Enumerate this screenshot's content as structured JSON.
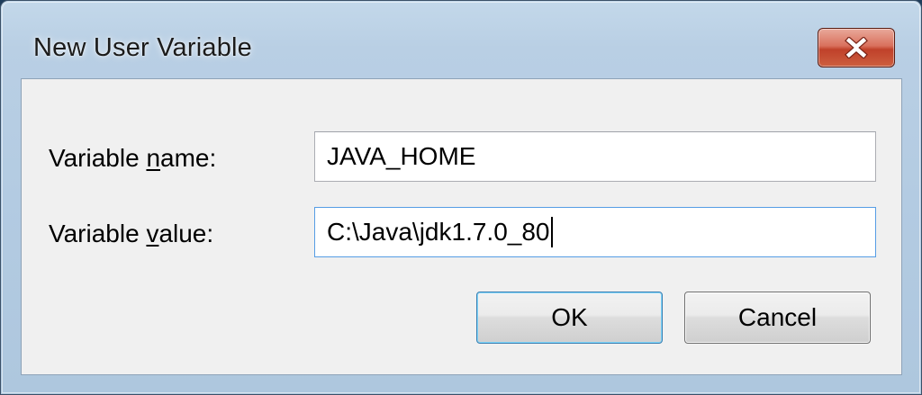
{
  "window": {
    "title": "New User Variable",
    "close_icon": "close-x-icon"
  },
  "form": {
    "name_label_prefix": "Variable ",
    "name_label_mnemonic": "n",
    "name_label_suffix": "ame:",
    "name_value": "JAVA_HOME",
    "value_label_prefix": "Variable ",
    "value_label_mnemonic": "v",
    "value_label_suffix": "alue:",
    "value_value": "C:\\Java\\jdk1.7.0_80"
  },
  "buttons": {
    "ok_label": "OK",
    "cancel_label": "Cancel"
  },
  "colors": {
    "frame": "#b3cbe2",
    "close_button": "#c0412a",
    "client_bg": "#f0f0f0",
    "focus_border": "#569de5"
  }
}
